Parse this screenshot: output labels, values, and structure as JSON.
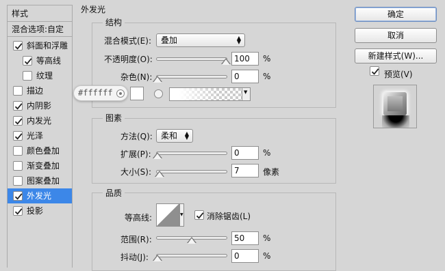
{
  "left_panel": {
    "header": "样式",
    "blend_options": "混合选项:自定",
    "items": [
      {
        "label": "斜面和浮雕",
        "checked": true,
        "selected": false,
        "indent": false
      },
      {
        "label": "等高线",
        "checked": true,
        "selected": false,
        "indent": true
      },
      {
        "label": "纹理",
        "checked": false,
        "selected": false,
        "indent": true
      },
      {
        "label": "描边",
        "checked": false,
        "selected": false,
        "indent": false
      },
      {
        "label": "内阴影",
        "checked": true,
        "selected": false,
        "indent": false
      },
      {
        "label": "内发光",
        "checked": true,
        "selected": false,
        "indent": false
      },
      {
        "label": "光泽",
        "checked": true,
        "selected": false,
        "indent": false
      },
      {
        "label": "颜色叠加",
        "checked": false,
        "selected": false,
        "indent": false
      },
      {
        "label": "渐变叠加",
        "checked": false,
        "selected": false,
        "indent": false
      },
      {
        "label": "图案叠加",
        "checked": false,
        "selected": false,
        "indent": false
      },
      {
        "label": "外发光",
        "checked": true,
        "selected": true,
        "indent": false
      },
      {
        "label": "投影",
        "checked": true,
        "selected": false,
        "indent": false
      }
    ]
  },
  "outer_glow": {
    "title": "外发光",
    "structure": {
      "title": "结构",
      "blend_mode_label": "混合模式(E):",
      "blend_mode_value": "叠加",
      "opacity_label": "不透明度(O):",
      "opacity_value": "100",
      "opacity_level": 1.0,
      "noise_label": "杂色(N):",
      "noise_value": "0",
      "noise_level": 0.0,
      "percent": "%",
      "hex_color": "#ffffff"
    },
    "elements": {
      "title": "图素",
      "method_label": "方法(Q):",
      "method_value": "柔和",
      "spread_label": "扩展(P):",
      "spread_value": "0",
      "spread_level": 0.0,
      "size_label": "大小(S):",
      "size_value": "7",
      "size_level": 0.03,
      "size_unit": "像素",
      "percent": "%"
    },
    "quality": {
      "title": "品质",
      "contour_label": "等高线:",
      "antialias_label": "消除锯齿(L)",
      "antialias_checked": true,
      "range_label": "范围(R):",
      "range_value": "50",
      "range_level": 0.5,
      "jitter_label": "抖动(J):",
      "jitter_value": "0",
      "jitter_level": 0.0,
      "percent": "%"
    }
  },
  "buttons": {
    "ok": "确定",
    "cancel": "取消",
    "new_style": "新建样式(W)...",
    "preview_label": "预览(V)",
    "preview_checked": true
  },
  "colors": {
    "selection": "#3c87e8",
    "panel_bg": "#d6d6d6"
  }
}
